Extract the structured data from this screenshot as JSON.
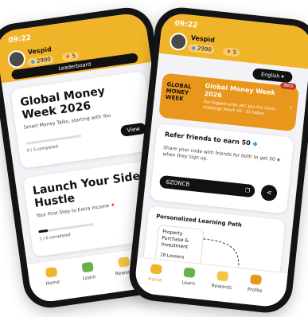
{
  "left": {
    "status_time": "09:22",
    "username": "Vespid",
    "gems": "2990",
    "streak": "5",
    "leaderboard_label": "Leaderboard",
    "cards": [
      {
        "title": "Global Money Week 2026",
        "subtitle": "Smart Money Talks, starting with You",
        "progress_text": "0 / 5 completed",
        "progress": 0.0,
        "button": "View"
      },
      {
        "title": "Launch Your Side Hustle",
        "subtitle": "Your First Step to Extra Income",
        "progress_text": "1 / 6 completed",
        "progress": 0.17
      }
    ],
    "tabs": [
      "Home",
      "Learn",
      "Rewards"
    ]
  },
  "right": {
    "status_time": "09:22",
    "username": "Vespid",
    "gems": "2990",
    "streak": "5",
    "language": "English",
    "beta": "Beta",
    "banner": {
      "logo_line1": "GLOBAL",
      "logo_line2": "MONEY",
      "logo_line3": "WEEK",
      "title": "Global Money Week 2026",
      "body": "Our biggest prize yet! Join the Genie challenge March 16 - 31 today!"
    },
    "refer": {
      "title": "Refer friends to earn 50",
      "body1": "Share your code with friends for both to get",
      "body2": "50",
      "body3": "when they sign up.",
      "code": "6ZONCB"
    },
    "path": {
      "title": "Personalized Learning Path",
      "item_title": "Property Purchase & Investment",
      "item_lessons": "18 Lessons"
    },
    "tabs": [
      "Home",
      "Learn",
      "Rewards",
      "Profile"
    ]
  },
  "colors": {
    "accent": "#f0b429",
    "dark": "#111111",
    "banner": "#e8961c"
  }
}
